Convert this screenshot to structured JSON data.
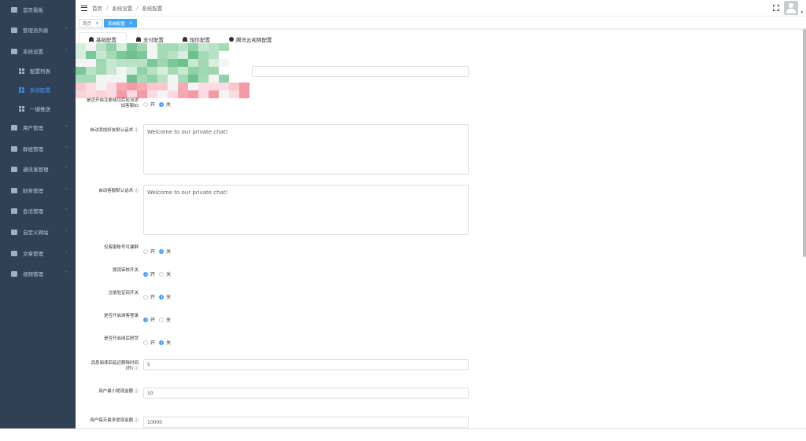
{
  "sidebar": {
    "items": [
      {
        "label": "首页看板",
        "icon": "dashboard-icon"
      },
      {
        "label": "管理员列表",
        "icon": "user-icon",
        "expandable": true
      },
      {
        "label": "系统设置",
        "icon": "gear-icon",
        "expandable": true,
        "expanded": true
      },
      {
        "label": "配置列表",
        "icon": "grid-icon",
        "sub": true
      },
      {
        "label": "系统配置",
        "icon": "grid-icon",
        "sub": true,
        "active": true
      },
      {
        "label": "一键推送",
        "icon": "grid-icon",
        "sub": true
      },
      {
        "label": "用户管理",
        "icon": "user-icon",
        "expandable": true
      },
      {
        "label": "群组管理",
        "icon": "group-icon",
        "expandable": true
      },
      {
        "label": "通讯录管理",
        "icon": "user-icon",
        "expandable": true
      },
      {
        "label": "财务管理",
        "icon": "chart-icon",
        "expandable": true
      },
      {
        "label": "会话管理",
        "icon": "chat-icon",
        "expandable": true
      },
      {
        "label": "自定义网站",
        "icon": "monitor-icon",
        "expandable": true
      },
      {
        "label": "文章管理",
        "icon": "document-icon",
        "expandable": true
      },
      {
        "label": "视频管理",
        "icon": "video-icon",
        "expandable": true
      }
    ]
  },
  "breadcrumb": [
    "首页",
    "系统设置",
    "系统配置"
  ],
  "tags": [
    {
      "label": "首页",
      "active": false
    },
    {
      "label": "系统配置",
      "active": true
    }
  ],
  "tabs": [
    {
      "label": "基础配置"
    },
    {
      "label": "支付配置"
    },
    {
      "label": "短信配置"
    },
    {
      "label": "腾讯云视频配置"
    }
  ],
  "radio_labels": {
    "on": "开",
    "off": "关"
  },
  "form": {
    "register_add_service": {
      "label": "是否开启注册成功后轮流添加客服ID",
      "value": "off"
    },
    "friend_greeting": {
      "label": "自动添加好友默认话术",
      "value": "Welcome to our private chat!"
    },
    "service_greeting": {
      "label": "自动客服默认话术",
      "value": "Welcome to our private chat!"
    },
    "service_only_group": {
      "label": "仅客服账号可建群",
      "value": "off"
    },
    "withdraw_review": {
      "label": "提现审核开关",
      "value": "on"
    },
    "register_captcha": {
      "label": "注册验证码开关",
      "value": "off"
    },
    "guest_login": {
      "label": "是否开启游客登录",
      "value": "on"
    },
    "burn_after_read": {
      "label": "是否开启阅后即焚",
      "value": "off"
    },
    "delete_delay": {
      "label": "消息阅读后延迟删除时间(秒)",
      "value": "5"
    },
    "min_withdraw": {
      "label": "用户最小提现金额",
      "value": "10"
    },
    "max_withdraw": {
      "label": "用户每天最多提现金额",
      "value": "10000"
    }
  },
  "info_icon": "ⓘ"
}
